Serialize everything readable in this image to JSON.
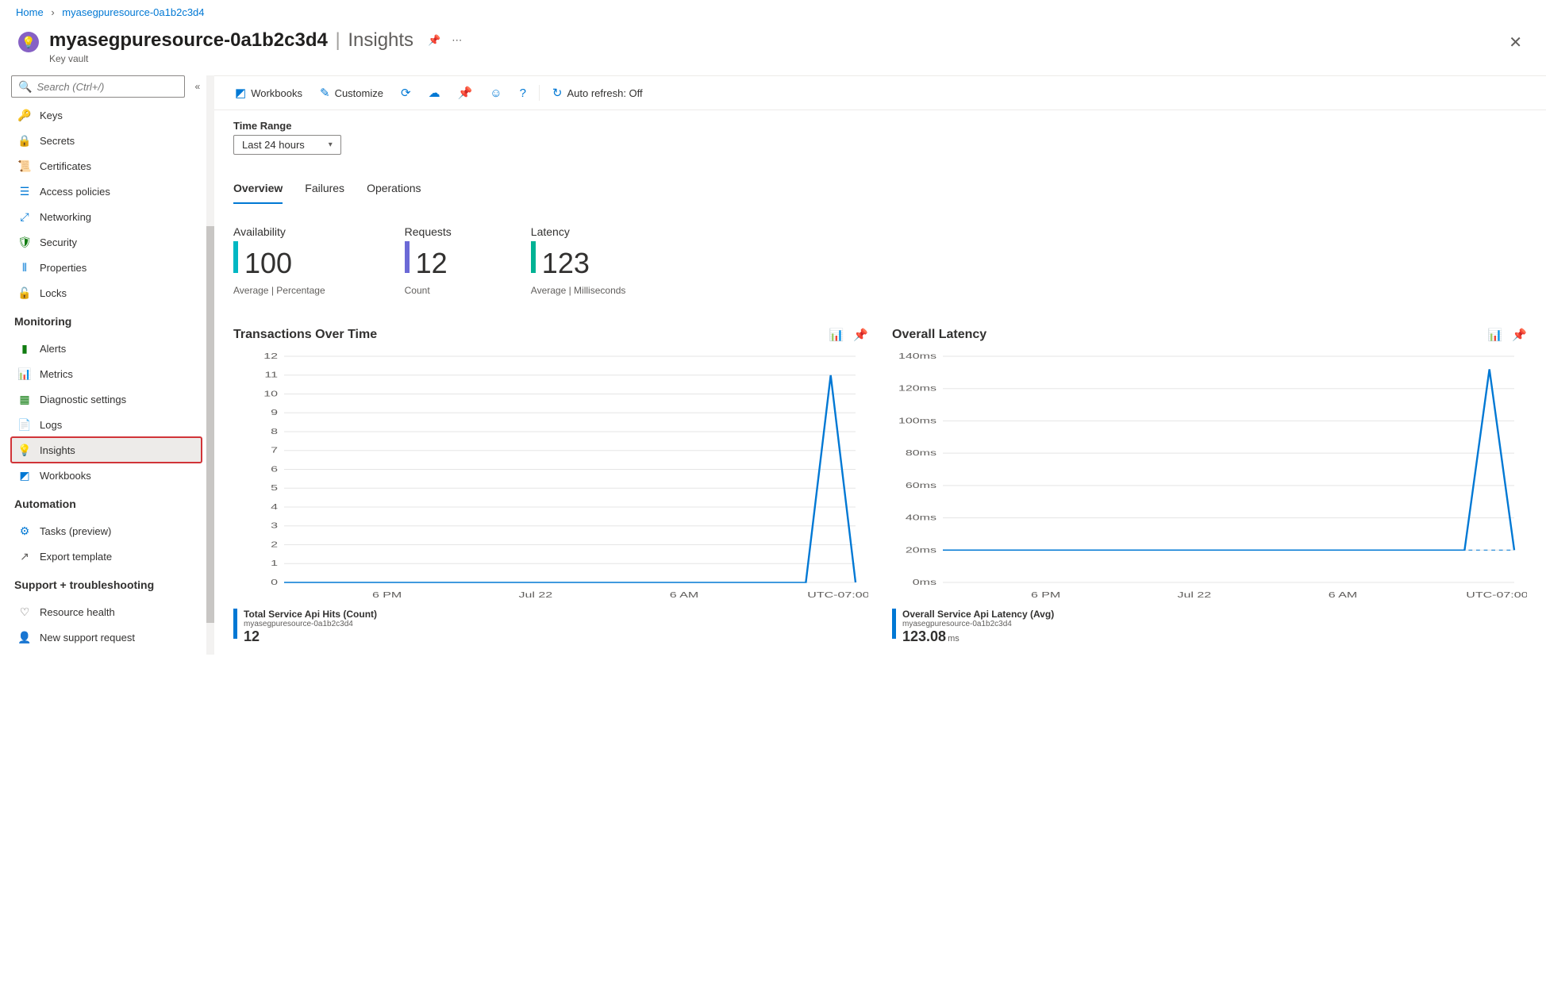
{
  "breadcrumb": {
    "home": "Home",
    "resource": "myasegpuresource-0a1b2c3d4"
  },
  "header": {
    "title": "myasegpuresource-0a1b2c3d4",
    "section": "Insights",
    "subtitle": "Key vault"
  },
  "sidebar": {
    "search_placeholder": "Search (Ctrl+/)",
    "items": [
      {
        "label": "Keys",
        "icon": "🔑",
        "color": "#ffb900"
      },
      {
        "label": "Secrets",
        "icon": "🔒",
        "color": "#ffb900"
      },
      {
        "label": "Certificates",
        "icon": "📜",
        "color": "#d83b01"
      },
      {
        "label": "Access policies",
        "icon": "☰",
        "color": "#0078d4"
      },
      {
        "label": "Networking",
        "icon": "⤢",
        "color": "#0078d4"
      },
      {
        "label": "Security",
        "icon": "🛡",
        "color": "#107c10"
      },
      {
        "label": "Properties",
        "icon": "⫴",
        "color": "#0078d4"
      },
      {
        "label": "Locks",
        "icon": "🔓",
        "color": "#0078d4"
      }
    ],
    "sections": {
      "monitoring": {
        "title": "Monitoring",
        "items": [
          {
            "label": "Alerts",
            "icon": "▮",
            "color": "#107c10"
          },
          {
            "label": "Metrics",
            "icon": "📊",
            "color": "#0078d4"
          },
          {
            "label": "Diagnostic settings",
            "icon": "▦",
            "color": "#107c10"
          },
          {
            "label": "Logs",
            "icon": "📄",
            "color": "#ff8c00"
          },
          {
            "label": "Insights",
            "icon": "💡",
            "color": "#8661c5",
            "selected": true
          },
          {
            "label": "Workbooks",
            "icon": "◩",
            "color": "#0078d4"
          }
        ]
      },
      "automation": {
        "title": "Automation",
        "items": [
          {
            "label": "Tasks (preview)",
            "icon": "⚙",
            "color": "#0078d4"
          },
          {
            "label": "Export template",
            "icon": "↗",
            "color": "#605e5c"
          }
        ]
      },
      "support": {
        "title": "Support + troubleshooting",
        "items": [
          {
            "label": "Resource health",
            "icon": "♡",
            "color": "#605e5c"
          },
          {
            "label": "New support request",
            "icon": "👤",
            "color": "#605e5c"
          }
        ]
      }
    }
  },
  "toolbar": {
    "workbooks": "Workbooks",
    "customize": "Customize",
    "auto_refresh": "Auto refresh: Off"
  },
  "time_range": {
    "label": "Time Range",
    "value": "Last 24 hours"
  },
  "tabs": [
    {
      "label": "Overview",
      "active": true
    },
    {
      "label": "Failures",
      "active": false
    },
    {
      "label": "Operations",
      "active": false
    }
  ],
  "metrics": [
    {
      "title": "Availability",
      "value": "100",
      "sub": "Average | Percentage",
      "color": "#00b7c3"
    },
    {
      "title": "Requests",
      "value": "12",
      "sub": "Count",
      "color": "#6b69d6"
    },
    {
      "title": "Latency",
      "value": "123",
      "sub": "Average | Milliseconds",
      "color": "#00b294"
    }
  ],
  "charts": {
    "transactions": {
      "title": "Transactions Over Time",
      "legend_title": "Total Service Api Hits (Count)",
      "legend_sub": "myasegpuresource-0a1b2c3d4",
      "legend_value": "12",
      "legend_unit": ""
    },
    "latency": {
      "title": "Overall Latency",
      "legend_title": "Overall Service Api Latency (Avg)",
      "legend_sub": "myasegpuresource-0a1b2c3d4",
      "legend_value": "123.08",
      "legend_unit": "ms"
    }
  },
  "chart_data": [
    {
      "type": "line",
      "title": "Transactions Over Time",
      "xlabel": "",
      "ylabel": "",
      "ylim": [
        0,
        12
      ],
      "y_ticks": [
        0,
        1,
        2,
        3,
        4,
        5,
        6,
        7,
        8,
        9,
        10,
        11,
        12
      ],
      "x_ticks": [
        "6 PM",
        "Jul 22",
        "6 AM",
        "UTC-07:00"
      ],
      "series": [
        {
          "name": "Total Service Api Hits (Count)",
          "x": [
            0,
            1,
            2,
            3,
            4,
            5,
            6,
            7,
            8,
            9,
            10,
            11,
            12,
            13,
            14,
            15,
            16,
            17,
            18,
            19,
            20,
            21,
            22,
            23
          ],
          "values": [
            0,
            0,
            0,
            0,
            0,
            0,
            0,
            0,
            0,
            0,
            0,
            0,
            0,
            0,
            0,
            0,
            0,
            0,
            0,
            0,
            0,
            0,
            11,
            0
          ]
        }
      ]
    },
    {
      "type": "line",
      "title": "Overall Latency",
      "xlabel": "",
      "ylabel": "",
      "ylim": [
        0,
        140
      ],
      "y_ticks": [
        0,
        20,
        40,
        60,
        80,
        100,
        120,
        140
      ],
      "y_tick_labels": [
        "0ms",
        "20ms",
        "40ms",
        "60ms",
        "80ms",
        "100ms",
        "120ms",
        "140ms"
      ],
      "x_ticks": [
        "6 PM",
        "Jul 22",
        "6 AM",
        "UTC-07:00"
      ],
      "series": [
        {
          "name": "Overall Service Api Latency (Avg)",
          "x": [
            0,
            1,
            2,
            3,
            4,
            5,
            6,
            7,
            8,
            9,
            10,
            11,
            12,
            13,
            14,
            15,
            16,
            17,
            18,
            19,
            20,
            21,
            22,
            23
          ],
          "values": [
            20,
            20,
            20,
            20,
            20,
            20,
            20,
            20,
            20,
            20,
            20,
            20,
            20,
            20,
            20,
            20,
            20,
            20,
            20,
            20,
            20,
            20,
            132,
            20
          ]
        }
      ],
      "baseline": 20
    }
  ]
}
